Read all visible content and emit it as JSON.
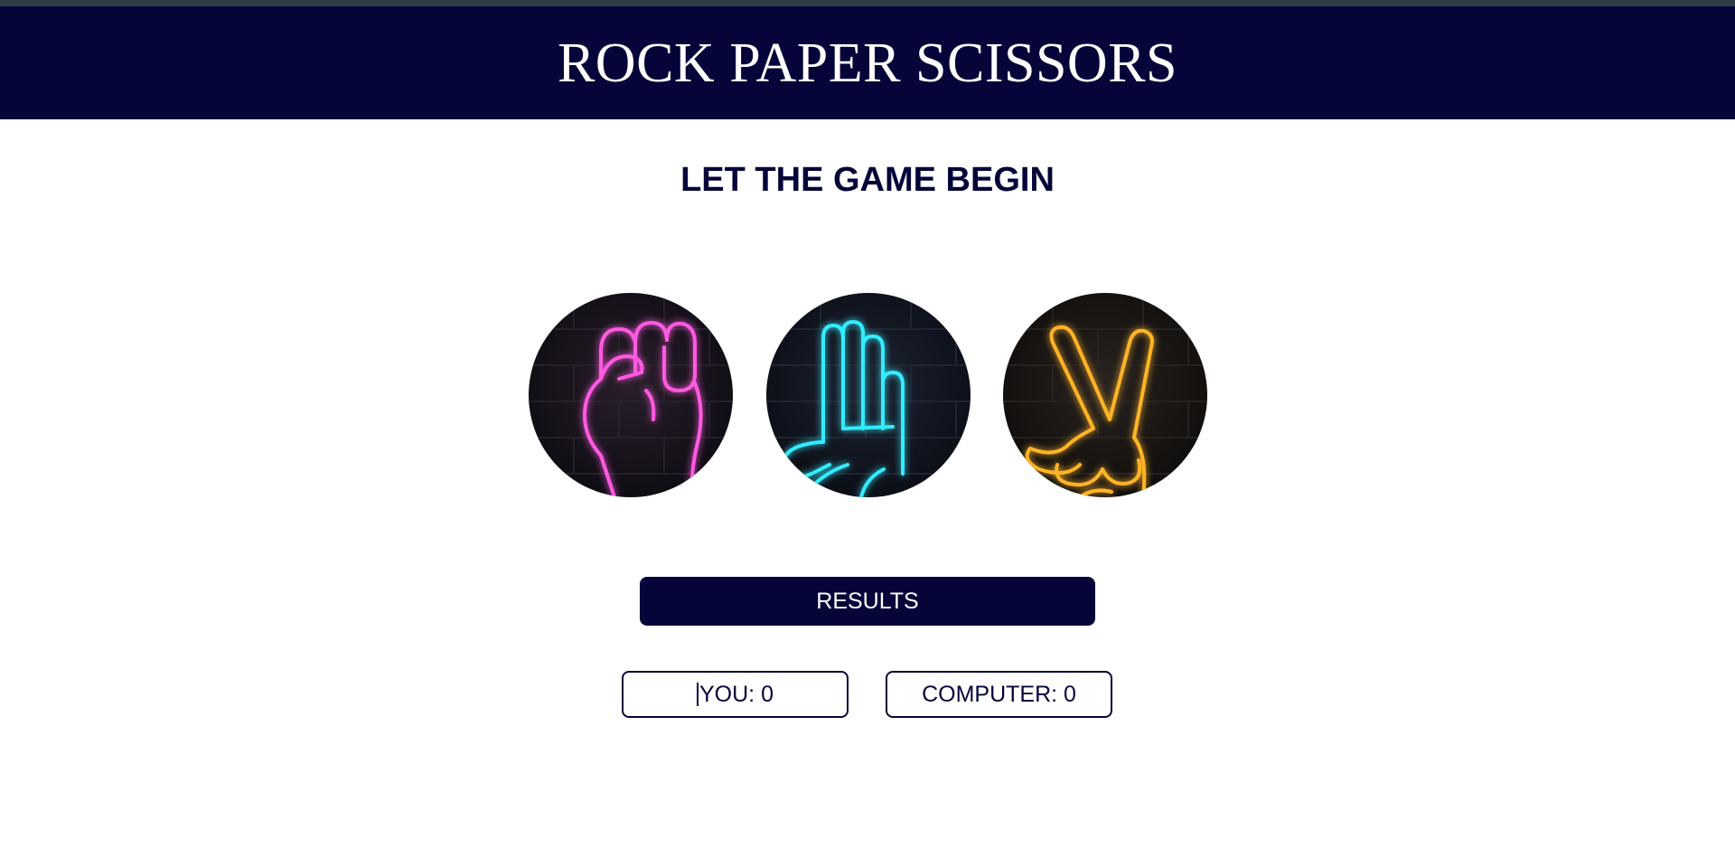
{
  "header": {
    "title": "ROCK PAPER SCISSORS"
  },
  "subtitle": "LET THE GAME BEGIN",
  "choices": [
    {
      "name": "rock",
      "icon": "neon-fist-icon",
      "color": "#ff4fd8"
    },
    {
      "name": "paper",
      "icon": "neon-open-hand-icon",
      "color": "#2fe3f5"
    },
    {
      "name": "scissors",
      "icon": "neon-peace-hand-icon",
      "color": "#ffb020"
    }
  ],
  "results_button": {
    "label": "RESULTS"
  },
  "scores": {
    "you": "YOU: 0",
    "computer": "COMPUTER: 0"
  },
  "colors": {
    "navy": "#05053a",
    "brick": "#15131c"
  }
}
